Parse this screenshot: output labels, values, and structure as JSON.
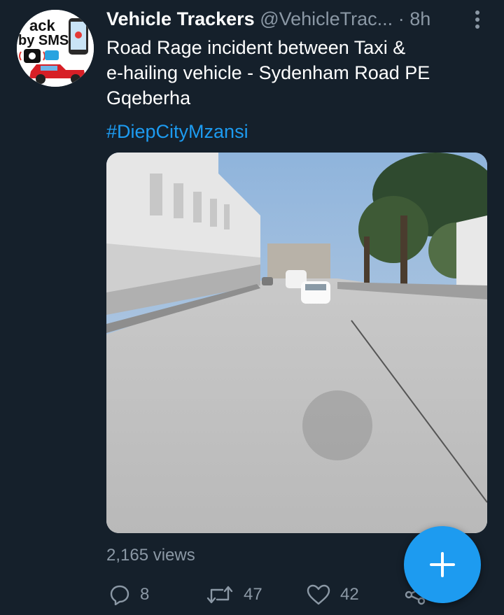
{
  "author": {
    "name": "Vehicle Trackers",
    "handle": "@VehicleTrac...",
    "separator": "·",
    "time": "8h",
    "avatar_text_line1": "ack",
    "avatar_text_line2": "by SMS"
  },
  "tweet": {
    "text_line1": "Road Rage incident between Taxi &",
    "text_line2": "e-hailing vehicle - Sydenham Road PE",
    "text_line3": "Gqeberha",
    "hashtag": "#DiepCityMzansi"
  },
  "stats": {
    "views": "2,165 views",
    "replies": "8",
    "retweets": "47",
    "likes": "42"
  },
  "icons": {
    "more": "more-vertical-icon",
    "reply": "reply-icon",
    "retweet": "retweet-icon",
    "like": "heart-icon",
    "share": "share-icon",
    "compose": "plus-icon"
  },
  "colors": {
    "background": "#15202b",
    "accent": "#1d9bf0",
    "secondary_text": "#8b98a5"
  }
}
